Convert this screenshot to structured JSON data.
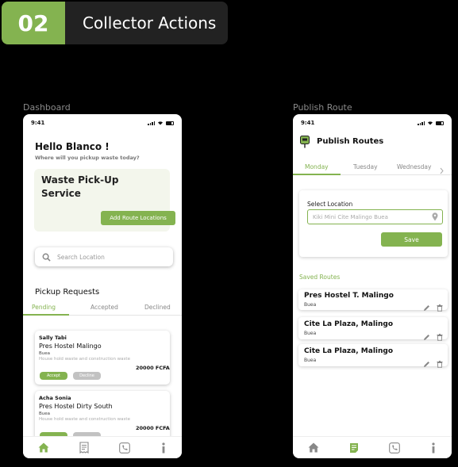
{
  "header": {
    "number": "02",
    "title": "Collector Actions"
  },
  "captions": {
    "dashboard": "Dashboard",
    "publish": "Publish Route"
  },
  "status_bar": {
    "time": "9:41"
  },
  "dashboard": {
    "greeting": "Hello Blanco !",
    "subtitle": "Where will you pickup waste today?",
    "service_title_line1": "Waste Pick-Up",
    "service_title_line2": "Service",
    "add_route_label": "Add Route Locations",
    "search_placeholder": "Search Location",
    "section_title": "Pickup Requests",
    "tabs": [
      "Pending",
      "Accepted",
      "Declined"
    ],
    "requests": [
      {
        "name": "Sally Tabi",
        "place": "Pres Hostel Malingo",
        "city": "Buea",
        "description": "House hold waste and construction waste",
        "price": "20000 FCFA",
        "accept_label": "Accept",
        "decline_label": "Decline"
      },
      {
        "name": "Acha Sonia",
        "place": "Pres Hostel Dirty South",
        "city": "Buea",
        "description": "House hold waste and construction waste",
        "price": "20000 FCFA",
        "accept_label": "",
        "decline_label": ""
      }
    ],
    "nav": [
      "home-icon",
      "receipt-icon",
      "phone-icon",
      "info-icon"
    ]
  },
  "publish": {
    "title": "Publish Routes",
    "days": [
      "Monday",
      "Tuesday",
      "Wednesday"
    ],
    "select_label": "Select Location",
    "select_value": "Kiki Mini Cite Malingo Buea",
    "save_label": "Save",
    "saved_title": "Saved Routes",
    "routes": [
      {
        "name": "Pres Hostel T. Malingo",
        "city": "Buea"
      },
      {
        "name": "Cite La Plaza, Malingo",
        "city": "Buea"
      },
      {
        "name": "Cite La Plaza, Malingo",
        "city": "Buea"
      }
    ],
    "nav": [
      "home-icon",
      "route-list-icon",
      "phone-icon",
      "info-icon"
    ]
  },
  "colors": {
    "accent": "#84b350",
    "dark": "#222222",
    "background": "#000000"
  }
}
